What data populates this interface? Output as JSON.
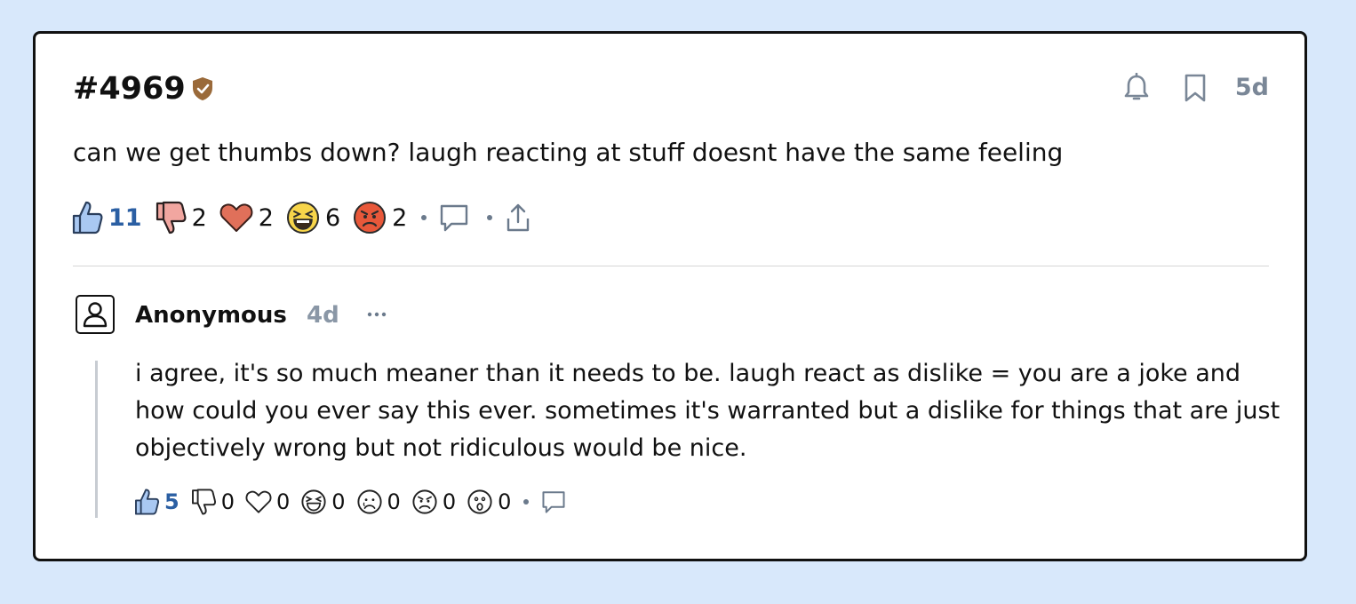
{
  "post": {
    "id": "#4969",
    "time": "5d",
    "body": "can we get thumbs down? laugh reacting at stuff doesnt have the same feeling",
    "reactions": {
      "thumbs_up": "11",
      "thumbs_down": "2",
      "heart": "2",
      "laugh": "6",
      "angry": "2"
    }
  },
  "comment": {
    "author": "Anonymous",
    "time": "4d",
    "body": "i agree, it's so much meaner than it needs to be. laugh react as dislike = you are a joke and how could you ever say this ever. sometimes it's warranted but a dislike for things that are just objectively wrong but not ridiculous would be nice.",
    "reactions": {
      "thumbs_up": "5",
      "thumbs_down": "0",
      "heart": "0",
      "laugh": "0",
      "sad": "0",
      "angry": "0",
      "surprised": "0"
    }
  },
  "colors": {
    "background": "#d8e8fb",
    "accent_blue": "#2b5fa3",
    "badge_brown": "#9a6a3a",
    "muted": "#7a8797"
  },
  "icons": [
    "shield-check-icon",
    "bell-icon",
    "bookmark-icon",
    "thumbs-up-icon",
    "thumbs-down-icon",
    "heart-icon",
    "laugh-emoji-icon",
    "angry-emoji-icon",
    "comment-icon",
    "share-icon",
    "user-icon",
    "more-icon",
    "sad-emoji-icon",
    "surprised-emoji-icon"
  ]
}
